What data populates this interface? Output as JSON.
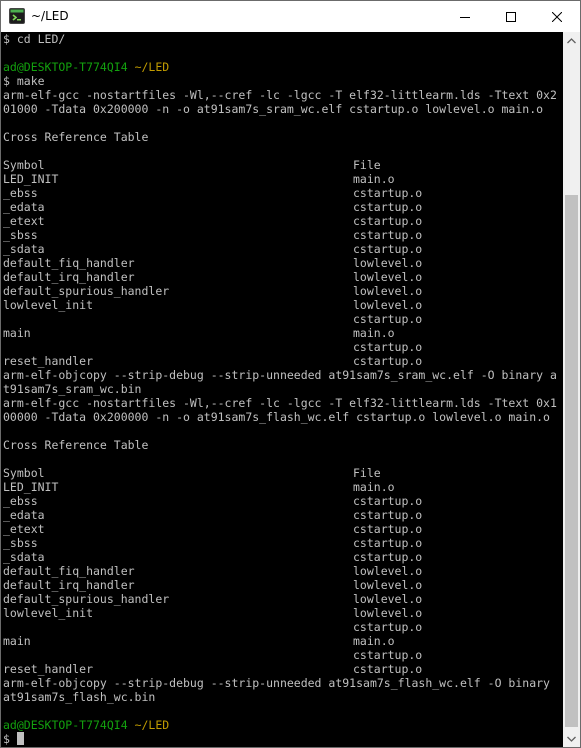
{
  "window": {
    "title": "~/LED",
    "controls": {
      "minimize": "minimize-icon",
      "maximize": "maximize-icon",
      "close": "close-icon"
    }
  },
  "terminal": {
    "lines": [
      {
        "type": "text",
        "text": "$ cd LED/"
      },
      {
        "type": "blank"
      },
      {
        "type": "prompt",
        "user": "ad@DESKTOP-T774QI4",
        "path": "~/LED"
      },
      {
        "type": "text",
        "text": "$ make"
      },
      {
        "type": "text",
        "text": "arm-elf-gcc -nostartfiles -Wl,--cref -lc -lgcc -T elf32-littlearm.lds -Ttext 0x2"
      },
      {
        "type": "text",
        "text": "01000 -Tdata 0x200000 -n -o at91sam7s_sram_wc.elf cstartup.o lowlevel.o main.o"
      },
      {
        "type": "blank"
      },
      {
        "type": "text",
        "text": "Cross Reference Table"
      },
      {
        "type": "blank"
      },
      {
        "type": "table",
        "sym": "Symbol",
        "file": "File"
      },
      {
        "type": "table",
        "sym": "LED_INIT",
        "file": "main.o"
      },
      {
        "type": "table",
        "sym": "_ebss",
        "file": "cstartup.o"
      },
      {
        "type": "table",
        "sym": "_edata",
        "file": "cstartup.o"
      },
      {
        "type": "table",
        "sym": "_etext",
        "file": "cstartup.o"
      },
      {
        "type": "table",
        "sym": "_sbss",
        "file": "cstartup.o"
      },
      {
        "type": "table",
        "sym": "_sdata",
        "file": "cstartup.o"
      },
      {
        "type": "table",
        "sym": "default_fiq_handler",
        "file": "lowlevel.o"
      },
      {
        "type": "table",
        "sym": "default_irq_handler",
        "file": "lowlevel.o"
      },
      {
        "type": "table",
        "sym": "default_spurious_handler",
        "file": "lowlevel.o"
      },
      {
        "type": "table",
        "sym": "lowlevel_init",
        "file": "lowlevel.o"
      },
      {
        "type": "table",
        "sym": "",
        "file": "cstartup.o"
      },
      {
        "type": "table",
        "sym": "main",
        "file": "main.o"
      },
      {
        "type": "table",
        "sym": "",
        "file": "cstartup.o"
      },
      {
        "type": "table",
        "sym": "reset_handler",
        "file": "cstartup.o"
      },
      {
        "type": "text",
        "text": "arm-elf-objcopy --strip-debug --strip-unneeded at91sam7s_sram_wc.elf -O binary a"
      },
      {
        "type": "text",
        "text": "t91sam7s_sram_wc.bin"
      },
      {
        "type": "text",
        "text": "arm-elf-gcc -nostartfiles -Wl,--cref -lc -lgcc -T elf32-littlearm.lds -Ttext 0x1"
      },
      {
        "type": "text",
        "text": "00000 -Tdata 0x200000 -n -o at91sam7s_flash_wc.elf cstartup.o lowlevel.o main.o"
      },
      {
        "type": "blank"
      },
      {
        "type": "text",
        "text": "Cross Reference Table"
      },
      {
        "type": "blank"
      },
      {
        "type": "table",
        "sym": "Symbol",
        "file": "File"
      },
      {
        "type": "table",
        "sym": "LED_INIT",
        "file": "main.o"
      },
      {
        "type": "table",
        "sym": "_ebss",
        "file": "cstartup.o"
      },
      {
        "type": "table",
        "sym": "_edata",
        "file": "cstartup.o"
      },
      {
        "type": "table",
        "sym": "_etext",
        "file": "cstartup.o"
      },
      {
        "type": "table",
        "sym": "_sbss",
        "file": "cstartup.o"
      },
      {
        "type": "table",
        "sym": "_sdata",
        "file": "cstartup.o"
      },
      {
        "type": "table",
        "sym": "default_fiq_handler",
        "file": "lowlevel.o"
      },
      {
        "type": "table",
        "sym": "default_irq_handler",
        "file": "lowlevel.o"
      },
      {
        "type": "table",
        "sym": "default_spurious_handler",
        "file": "lowlevel.o"
      },
      {
        "type": "table",
        "sym": "lowlevel_init",
        "file": "lowlevel.o"
      },
      {
        "type": "table",
        "sym": "",
        "file": "cstartup.o"
      },
      {
        "type": "table",
        "sym": "main",
        "file": "main.o"
      },
      {
        "type": "table",
        "sym": "",
        "file": "cstartup.o"
      },
      {
        "type": "table",
        "sym": "reset_handler",
        "file": "cstartup.o"
      },
      {
        "type": "text",
        "text": "arm-elf-objcopy --strip-debug --strip-unneeded at91sam7s_flash_wc.elf -O binary"
      },
      {
        "type": "text",
        "text": "at91sam7s_flash_wc.bin"
      },
      {
        "type": "blank"
      },
      {
        "type": "prompt",
        "user": "ad@DESKTOP-T774QI4",
        "path": "~/LED"
      },
      {
        "type": "cursor",
        "text": "$ "
      }
    ]
  },
  "scrollbar": {
    "up": "arrow-up-icon",
    "down": "arrow-down-icon"
  },
  "colors": {
    "background": "#000000",
    "text": "#c0c0c0",
    "prompt_user": "#13a10e",
    "prompt_path": "#c19c00",
    "titlebar": "#ffffff",
    "scrollbar_track": "#f0f0f0",
    "scrollbar_thumb": "#c1c1c1"
  }
}
